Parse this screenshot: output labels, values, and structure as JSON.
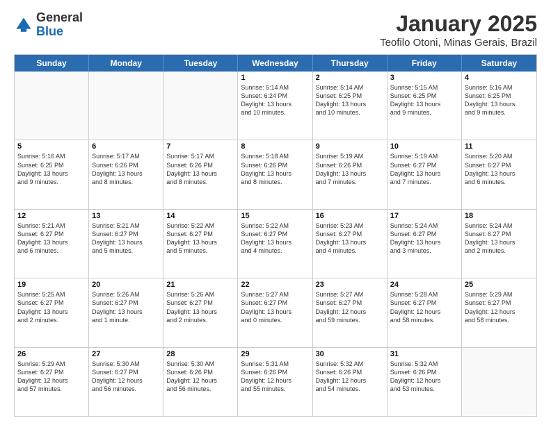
{
  "logo": {
    "general": "General",
    "blue": "Blue"
  },
  "header": {
    "title": "January 2025",
    "subtitle": "Teofilo Otoni, Minas Gerais, Brazil"
  },
  "weekdays": [
    "Sunday",
    "Monday",
    "Tuesday",
    "Wednesday",
    "Thursday",
    "Friday",
    "Saturday"
  ],
  "weeks": [
    [
      {
        "day": "",
        "text": "",
        "empty": true
      },
      {
        "day": "",
        "text": "",
        "empty": true
      },
      {
        "day": "",
        "text": "",
        "empty": true
      },
      {
        "day": "1",
        "text": "Sunrise: 5:14 AM\nSunset: 6:24 PM\nDaylight: 13 hours\nand 10 minutes.",
        "empty": false
      },
      {
        "day": "2",
        "text": "Sunrise: 5:14 AM\nSunset: 6:25 PM\nDaylight: 13 hours\nand 10 minutes.",
        "empty": false
      },
      {
        "day": "3",
        "text": "Sunrise: 5:15 AM\nSunset: 6:25 PM\nDaylight: 13 hours\nand 9 minutes.",
        "empty": false
      },
      {
        "day": "4",
        "text": "Sunrise: 5:16 AM\nSunset: 6:25 PM\nDaylight: 13 hours\nand 9 minutes.",
        "empty": false
      }
    ],
    [
      {
        "day": "5",
        "text": "Sunrise: 5:16 AM\nSunset: 6:25 PM\nDaylight: 13 hours\nand 9 minutes.",
        "empty": false
      },
      {
        "day": "6",
        "text": "Sunrise: 5:17 AM\nSunset: 6:26 PM\nDaylight: 13 hours\nand 8 minutes.",
        "empty": false
      },
      {
        "day": "7",
        "text": "Sunrise: 5:17 AM\nSunset: 6:26 PM\nDaylight: 13 hours\nand 8 minutes.",
        "empty": false
      },
      {
        "day": "8",
        "text": "Sunrise: 5:18 AM\nSunset: 6:26 PM\nDaylight: 13 hours\nand 8 minutes.",
        "empty": false
      },
      {
        "day": "9",
        "text": "Sunrise: 5:19 AM\nSunset: 6:26 PM\nDaylight: 13 hours\nand 7 minutes.",
        "empty": false
      },
      {
        "day": "10",
        "text": "Sunrise: 5:19 AM\nSunset: 6:27 PM\nDaylight: 13 hours\nand 7 minutes.",
        "empty": false
      },
      {
        "day": "11",
        "text": "Sunrise: 5:20 AM\nSunset: 6:27 PM\nDaylight: 13 hours\nand 6 minutes.",
        "empty": false
      }
    ],
    [
      {
        "day": "12",
        "text": "Sunrise: 5:21 AM\nSunset: 6:27 PM\nDaylight: 13 hours\nand 6 minutes.",
        "empty": false
      },
      {
        "day": "13",
        "text": "Sunrise: 5:21 AM\nSunset: 6:27 PM\nDaylight: 13 hours\nand 5 minutes.",
        "empty": false
      },
      {
        "day": "14",
        "text": "Sunrise: 5:22 AM\nSunset: 6:27 PM\nDaylight: 13 hours\nand 5 minutes.",
        "empty": false
      },
      {
        "day": "15",
        "text": "Sunrise: 5:22 AM\nSunset: 6:27 PM\nDaylight: 13 hours\nand 4 minutes.",
        "empty": false
      },
      {
        "day": "16",
        "text": "Sunrise: 5:23 AM\nSunset: 6:27 PM\nDaylight: 13 hours\nand 4 minutes.",
        "empty": false
      },
      {
        "day": "17",
        "text": "Sunrise: 5:24 AM\nSunset: 6:27 PM\nDaylight: 13 hours\nand 3 minutes.",
        "empty": false
      },
      {
        "day": "18",
        "text": "Sunrise: 5:24 AM\nSunset: 6:27 PM\nDaylight: 13 hours\nand 2 minutes.",
        "empty": false
      }
    ],
    [
      {
        "day": "19",
        "text": "Sunrise: 5:25 AM\nSunset: 6:27 PM\nDaylight: 13 hours\nand 2 minutes.",
        "empty": false
      },
      {
        "day": "20",
        "text": "Sunrise: 5:26 AM\nSunset: 6:27 PM\nDaylight: 13 hours\nand 1 minute.",
        "empty": false
      },
      {
        "day": "21",
        "text": "Sunrise: 5:26 AM\nSunset: 6:27 PM\nDaylight: 13 hours\nand 2 minutes.",
        "empty": false
      },
      {
        "day": "22",
        "text": "Sunrise: 5:27 AM\nSunset: 6:27 PM\nDaylight: 13 hours\nand 0 minutes.",
        "empty": false
      },
      {
        "day": "23",
        "text": "Sunrise: 5:27 AM\nSunset: 6:27 PM\nDaylight: 12 hours\nand 59 minutes.",
        "empty": false
      },
      {
        "day": "24",
        "text": "Sunrise: 5:28 AM\nSunset: 6:27 PM\nDaylight: 12 hours\nand 58 minutes.",
        "empty": false
      },
      {
        "day": "25",
        "text": "Sunrise: 5:29 AM\nSunset: 6:27 PM\nDaylight: 12 hours\nand 58 minutes.",
        "empty": false
      }
    ],
    [
      {
        "day": "26",
        "text": "Sunrise: 5:29 AM\nSunset: 6:27 PM\nDaylight: 12 hours\nand 57 minutes.",
        "empty": false
      },
      {
        "day": "27",
        "text": "Sunrise: 5:30 AM\nSunset: 6:27 PM\nDaylight: 12 hours\nand 56 minutes.",
        "empty": false
      },
      {
        "day": "28",
        "text": "Sunrise: 5:30 AM\nSunset: 6:26 PM\nDaylight: 12 hours\nand 56 minutes.",
        "empty": false
      },
      {
        "day": "29",
        "text": "Sunrise: 5:31 AM\nSunset: 6:26 PM\nDaylight: 12 hours\nand 55 minutes.",
        "empty": false
      },
      {
        "day": "30",
        "text": "Sunrise: 5:32 AM\nSunset: 6:26 PM\nDaylight: 12 hours\nand 54 minutes.",
        "empty": false
      },
      {
        "day": "31",
        "text": "Sunrise: 5:32 AM\nSunset: 6:26 PM\nDaylight: 12 hours\nand 53 minutes.",
        "empty": false
      },
      {
        "day": "",
        "text": "",
        "empty": true
      }
    ]
  ]
}
